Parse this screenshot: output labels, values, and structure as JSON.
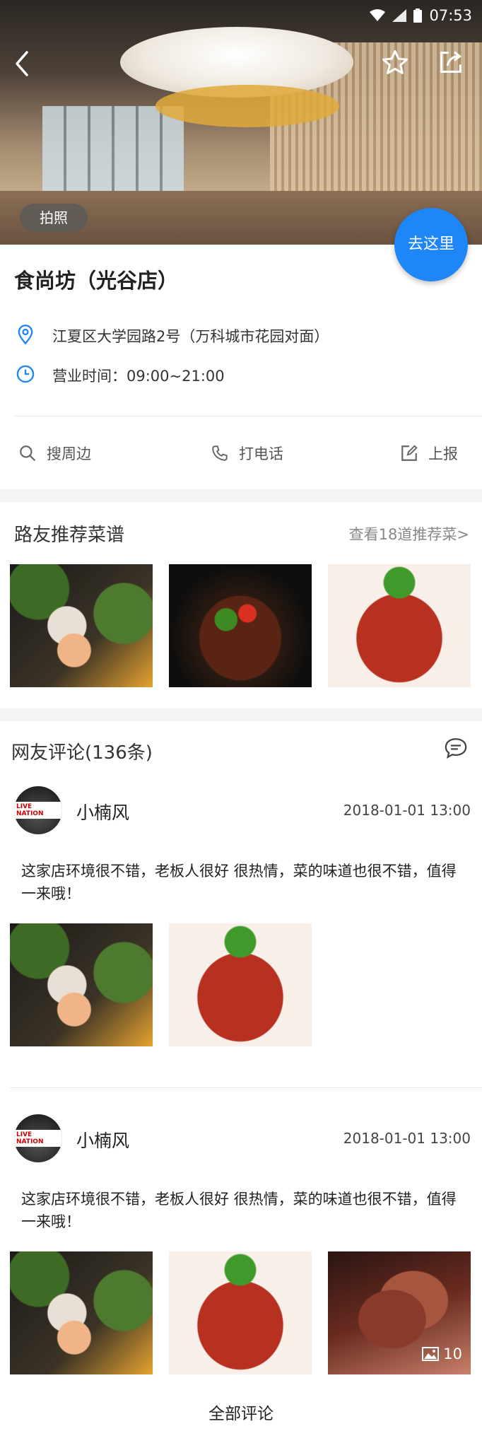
{
  "status_bar": {
    "time": "07:53"
  },
  "hero": {
    "photo_tag": "拍照",
    "goto_label": "去这里"
  },
  "shop": {
    "name": "食尚坊（光谷店）",
    "address": "江夏区大学园路2号（万科城市花园对面）",
    "hours": "营业时间：09:00~21:00"
  },
  "actions": [
    {
      "label": "搜周边",
      "icon": "search-icon"
    },
    {
      "label": "打电话",
      "icon": "phone-icon"
    },
    {
      "label": "上报",
      "icon": "edit-icon"
    }
  ],
  "recommend": {
    "title": "路友推荐菜谱",
    "more_link": "查看18道推荐菜>"
  },
  "comments": {
    "title": "网友评论(136条)",
    "items": [
      {
        "user": "小楠风",
        "date": "2018-01-01 13:00",
        "text": "这家店环境很不错，老板人很好 很热情，菜的味道也很不错，值得一来哦！"
      },
      {
        "user": "小楠风",
        "date": "2018-01-01 13:00",
        "text": "这家店环境很不错，老板人很好 很热情，菜的味道也很不错，值得一来哦！",
        "photo_count": "10"
      }
    ],
    "avatar_text": "LIVE NATION",
    "all_label": "全部评论"
  },
  "colors": {
    "accent": "#1e86f6",
    "separator": "#f4f4f4"
  }
}
